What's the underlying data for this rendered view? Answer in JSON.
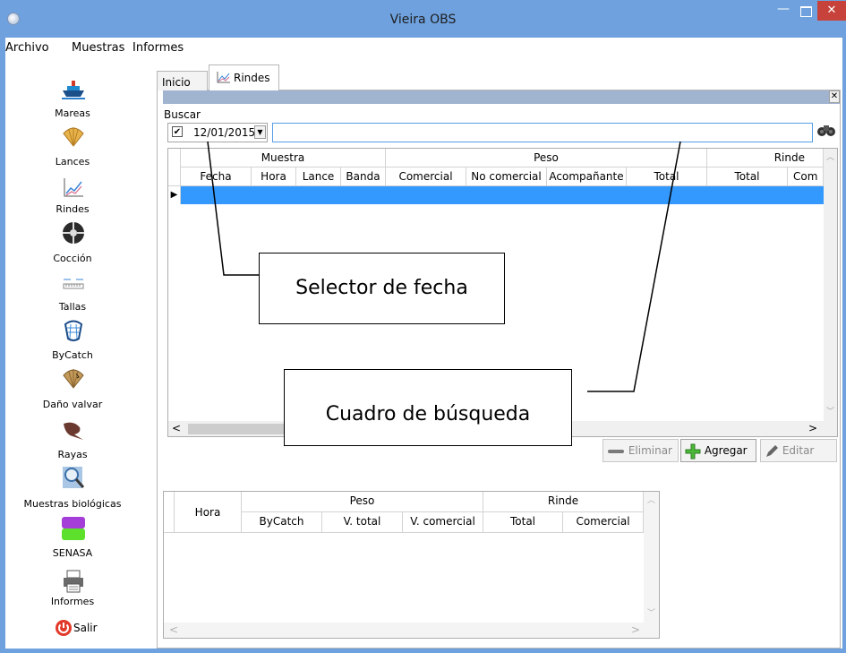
{
  "window": {
    "title": "Vieira OBS",
    "minimize_glyph": "—",
    "close_glyph": "✕"
  },
  "menu": [
    "Archivo",
    "Muestras",
    "Informes"
  ],
  "sidebar": {
    "items": [
      {
        "label": "Mareas",
        "icon": "ship-icon"
      },
      {
        "label": "Lances",
        "icon": "scallop-icon"
      },
      {
        "label": "Rindes",
        "icon": "chart-icon"
      },
      {
        "label": "Cocción",
        "icon": "wheel-icon"
      },
      {
        "label": "Tallas",
        "icon": "ruler-icon"
      },
      {
        "label": "ByCatch",
        "icon": "net-icon"
      },
      {
        "label": "Daño valvar",
        "icon": "damaged-shell-icon"
      },
      {
        "label": "Rayas",
        "icon": "ray-icon"
      },
      {
        "label": "Muestras biológicas",
        "icon": "magnifier-icon"
      },
      {
        "label": "SENASA",
        "icon": "senasa-icon"
      },
      {
        "label": "Informes",
        "icon": "printer-icon"
      }
    ],
    "exit_label": "Salir"
  },
  "tabs": {
    "inicio": "Inicio",
    "rindes": "Rindes"
  },
  "form": {
    "close_glyph": "✕",
    "buscar_label": "Buscar",
    "date_checked": "✔",
    "date_value": "12/01/2015",
    "search_value": "",
    "search_icon_glyph": "☉"
  },
  "grid1": {
    "group_headers": [
      "Muestra",
      "Peso",
      "Rinde"
    ],
    "columns": [
      "Fecha",
      "Hora",
      "Lance",
      "Banda",
      "Comercial",
      "No comercial",
      "Acompañante",
      "Total",
      "Total",
      "Com"
    ],
    "row_indicator": "▶"
  },
  "actions": {
    "eliminar": "Eliminar",
    "agregar": "Agregar",
    "editar": "Editar"
  },
  "grid2": {
    "hora": "Hora",
    "group_headers": [
      "Peso",
      "Rinde"
    ],
    "columns": [
      "ByCatch",
      "V. total",
      "V. comercial",
      "Total",
      "Comercial"
    ]
  },
  "annotations": {
    "date_selector": "Selector de fecha",
    "search_box": "Cuadro de búsqueda"
  },
  "colors": {
    "titlebar": "#6ea1de",
    "selection": "#3399ff",
    "close_button": "#c7423a"
  }
}
